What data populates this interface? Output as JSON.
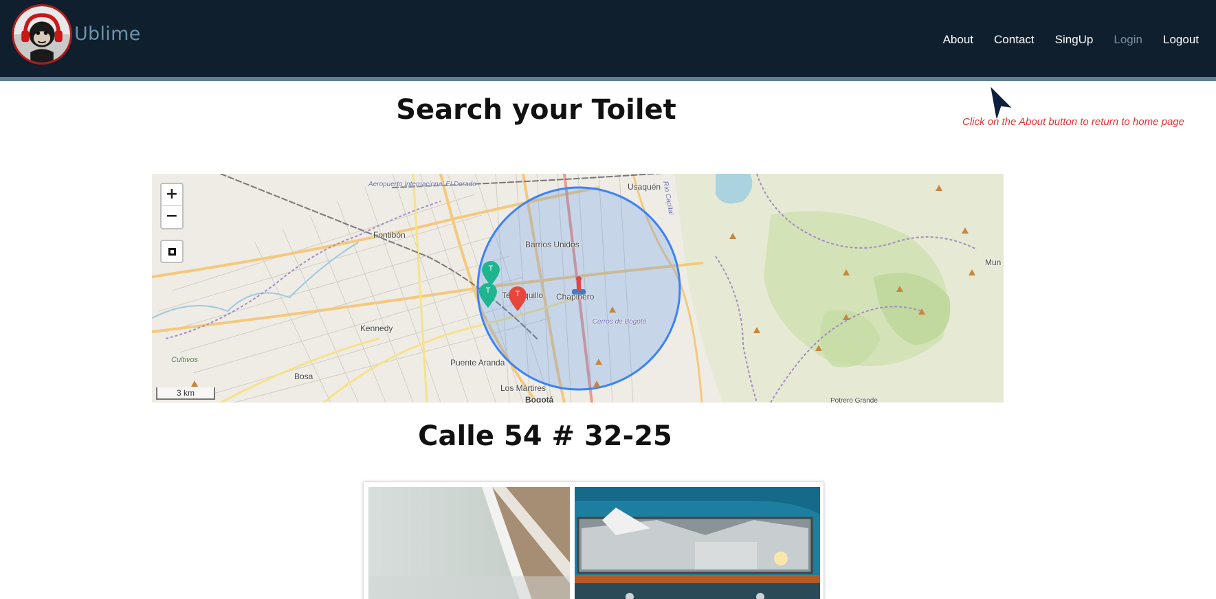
{
  "header": {
    "brand": "Ublime",
    "nav": [
      {
        "label": "About",
        "active": false
      },
      {
        "label": "Contact",
        "active": false
      },
      {
        "label": "SingUp",
        "active": false
      },
      {
        "label": "Login",
        "active": true
      },
      {
        "label": "Logout",
        "active": false
      }
    ]
  },
  "hint": "Click on the About button to return to home page",
  "page": {
    "title": "Search your Toilet",
    "address": "Calle 54 # 32-25"
  },
  "map": {
    "zoom_in": "+",
    "zoom_out": "−",
    "scale": "3 km",
    "places": {
      "airport": "Aeropuerto Internacional El Dorado",
      "usaquen": "Usaquén",
      "fontibon": "Fontibón",
      "barrios_unidos": "Barrios Unidos",
      "teusaquillo": "Teusaquillo",
      "chapinero": "Chapinero",
      "cerros": "Cerros de Bogotá",
      "kennedy": "Kennedy",
      "puente_aranda": "Puente Aranda",
      "los_martires": "Los Mártires",
      "bosa": "Bosa",
      "cultivos": "Cultivos",
      "bogota": "Bogotá",
      "potrero_grande": "Potrero Grande",
      "mun": "Mun",
      "cano_capital": "Río Capital"
    },
    "markers": [
      {
        "label": "T",
        "color": "#1fb58f"
      },
      {
        "label": "T",
        "color": "#1fb58f"
      },
      {
        "label": "T",
        "color": "#e8463a"
      }
    ],
    "radius_color": "#3b82f6"
  },
  "colors": {
    "header_bg": "#0f1f2e",
    "brand": "#6b93ab",
    "hint": "#e8302e",
    "active_nav": "#7a8fa0"
  }
}
